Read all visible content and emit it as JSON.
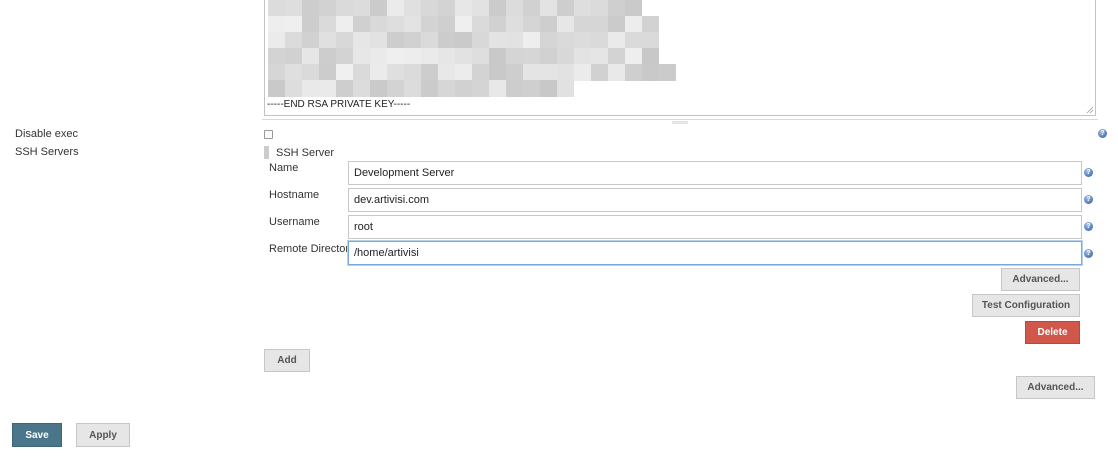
{
  "key_field": {
    "end_line": "-----END RSA PRIVATE KEY-----"
  },
  "disable_exec": {
    "label": "Disable exec",
    "checked": false,
    "help_icon": "help-icon"
  },
  "ssh_servers": {
    "label": "SSH Servers",
    "server": {
      "header": "SSH Server",
      "fields": {
        "name": {
          "label": "Name",
          "value": "Development Server"
        },
        "hostname": {
          "label": "Hostname",
          "value": "dev.artivisi.com"
        },
        "username": {
          "label": "Username",
          "value": "root"
        },
        "remote_directory": {
          "label": "Remote Directory",
          "value": "/home/artivisi"
        }
      },
      "advanced_label": "Advanced...",
      "test_label": "Test Configuration",
      "delete_label": "Delete"
    },
    "add_label": "Add",
    "advanced_label": "Advanced..."
  },
  "footer": {
    "save_label": "Save",
    "apply_label": "Apply"
  },
  "colors": {
    "delete": "#d0574a",
    "save": "#4b758b",
    "focus": "#7aa7dc"
  }
}
